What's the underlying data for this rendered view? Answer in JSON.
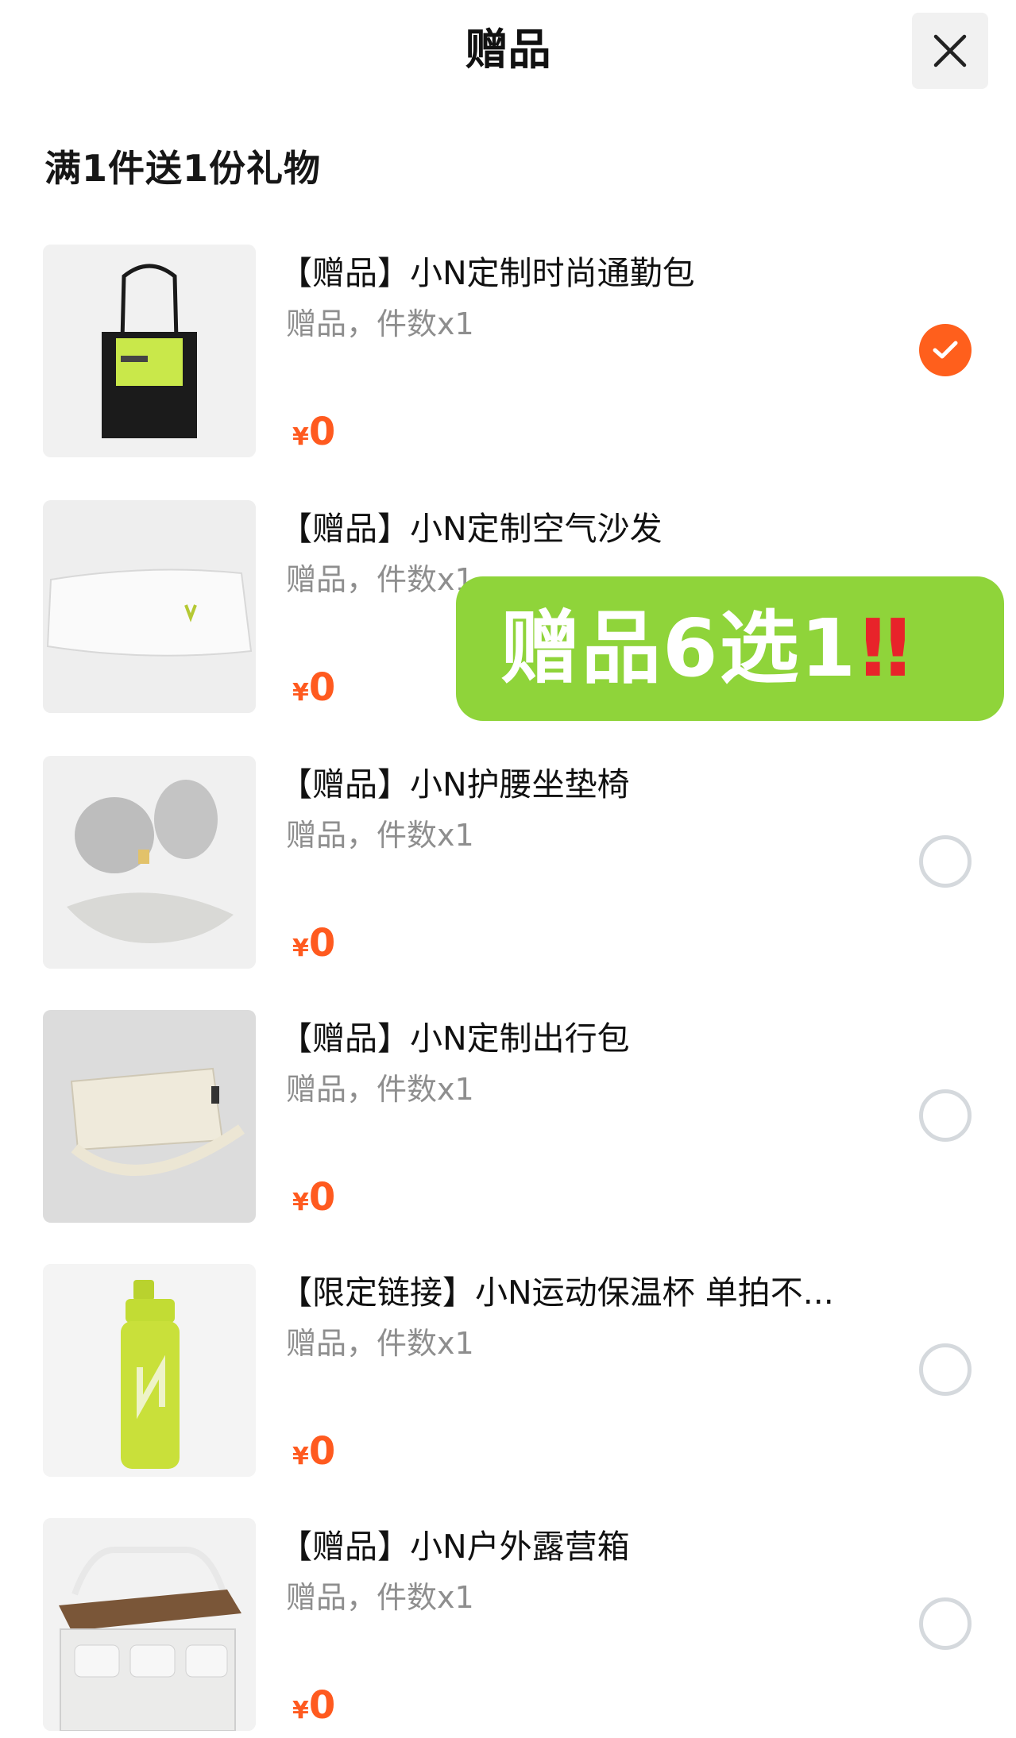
{
  "header": {
    "title": "赠品",
    "close_icon": "close-icon"
  },
  "section": {
    "title": "满1件送1份礼物"
  },
  "items": [
    {
      "title": "【赠品】小N定制时尚通勤包",
      "subtitle": "赠品，件数x1",
      "currency": "¥",
      "price": "0",
      "selected": true,
      "image": "tote-bag"
    },
    {
      "title": "【赠品】小N定制空气沙发",
      "subtitle": "赠品，件数x1",
      "currency": "¥",
      "price": "0",
      "selected": false,
      "image": "air-sofa"
    },
    {
      "title": "【赠品】小N护腰坐垫椅",
      "subtitle": "赠品，件数x1",
      "currency": "¥",
      "price": "0",
      "selected": false,
      "image": "cushion-chair"
    },
    {
      "title": "【赠品】小N定制出行包",
      "subtitle": "赠品，件数x1",
      "currency": "¥",
      "price": "0",
      "selected": false,
      "image": "travel-pouch"
    },
    {
      "title": "【限定链接】小N运动保温杯  单拍不...",
      "subtitle": "赠品，件数x1",
      "currency": "¥",
      "price": "0",
      "selected": false,
      "image": "thermos-bottle"
    },
    {
      "title": "【赠品】小N户外露营箱",
      "subtitle": "赠品，件数x1",
      "currency": "¥",
      "price": "0",
      "selected": false,
      "image": "camping-box"
    }
  ],
  "overlay": {
    "text": "赠品6选1",
    "emphasis": "‼"
  },
  "colors": {
    "accent": "#ff5a1f",
    "badge_green": "#8fd43a",
    "subtitle_gray": "#8e8e8e"
  }
}
